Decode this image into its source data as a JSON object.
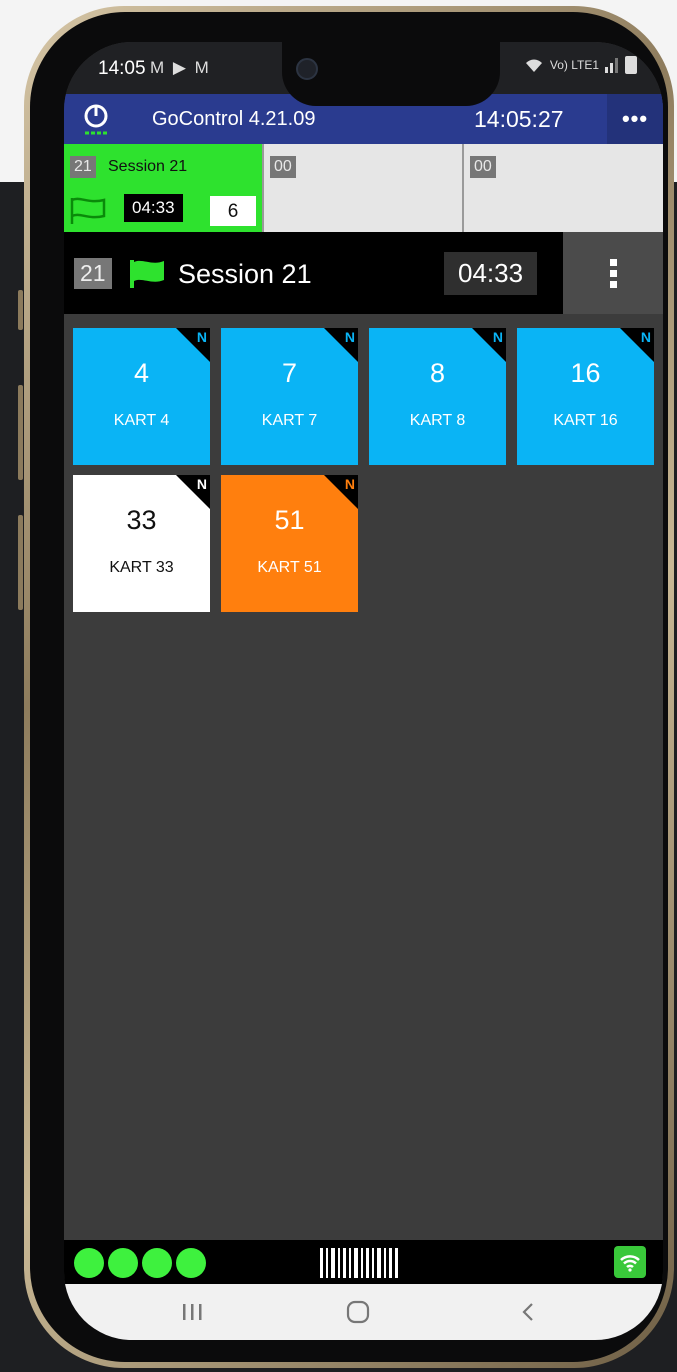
{
  "status_bar": {
    "time": "14:05",
    "icons": "M ▶ M",
    "network": "Vo) LTE1"
  },
  "app_bar": {
    "title": "GoControl 4.21.09",
    "clock": "14:05:27",
    "menu": "•••"
  },
  "session_tabs": [
    {
      "number": "21",
      "label": "Session 21",
      "timer": "04:33",
      "count": "6",
      "active": true
    },
    {
      "number": "00",
      "active": false
    },
    {
      "number": "00",
      "active": false
    }
  ],
  "session_header": {
    "number": "21",
    "title": "Session 21",
    "timer": "04:33"
  },
  "karts": [
    {
      "number": "4",
      "label": "KART 4",
      "badge": "N",
      "color": "#0ab4f5",
      "badge_color": "#0ab4f5",
      "text_color": "#ffffff"
    },
    {
      "number": "7",
      "label": "KART 7",
      "badge": "N",
      "color": "#0ab4f5",
      "badge_color": "#0ab4f5",
      "text_color": "#ffffff"
    },
    {
      "number": "8",
      "label": "KART 8",
      "badge": "N",
      "color": "#0ab4f5",
      "badge_color": "#0ab4f5",
      "text_color": "#ffffff"
    },
    {
      "number": "16",
      "label": "KART 16",
      "badge": "N",
      "color": "#0ab4f5",
      "badge_color": "#0ab4f5",
      "text_color": "#ffffff"
    },
    {
      "number": "33",
      "label": "KART 33",
      "badge": "N",
      "color": "#ffffff",
      "badge_color": "#ffffff",
      "text_color": "#111111"
    },
    {
      "number": "51",
      "label": "KART 51",
      "badge": "N",
      "color": "#ff7f0e",
      "badge_color": "#ff7f0e",
      "text_color": "#ffffff"
    }
  ],
  "colors": {
    "app_bar": "#2a3b8f",
    "active_tab": "#2ee22e",
    "screen_bg": "#3c3c3c",
    "led": "#3ef13e"
  },
  "bottom_bar": {
    "led_count": 4,
    "wifi_icon": "wifi-icon",
    "barcode_icon": "barcode-icon"
  },
  "nav_icons": [
    "recents-icon",
    "home-icon",
    "back-icon"
  ]
}
